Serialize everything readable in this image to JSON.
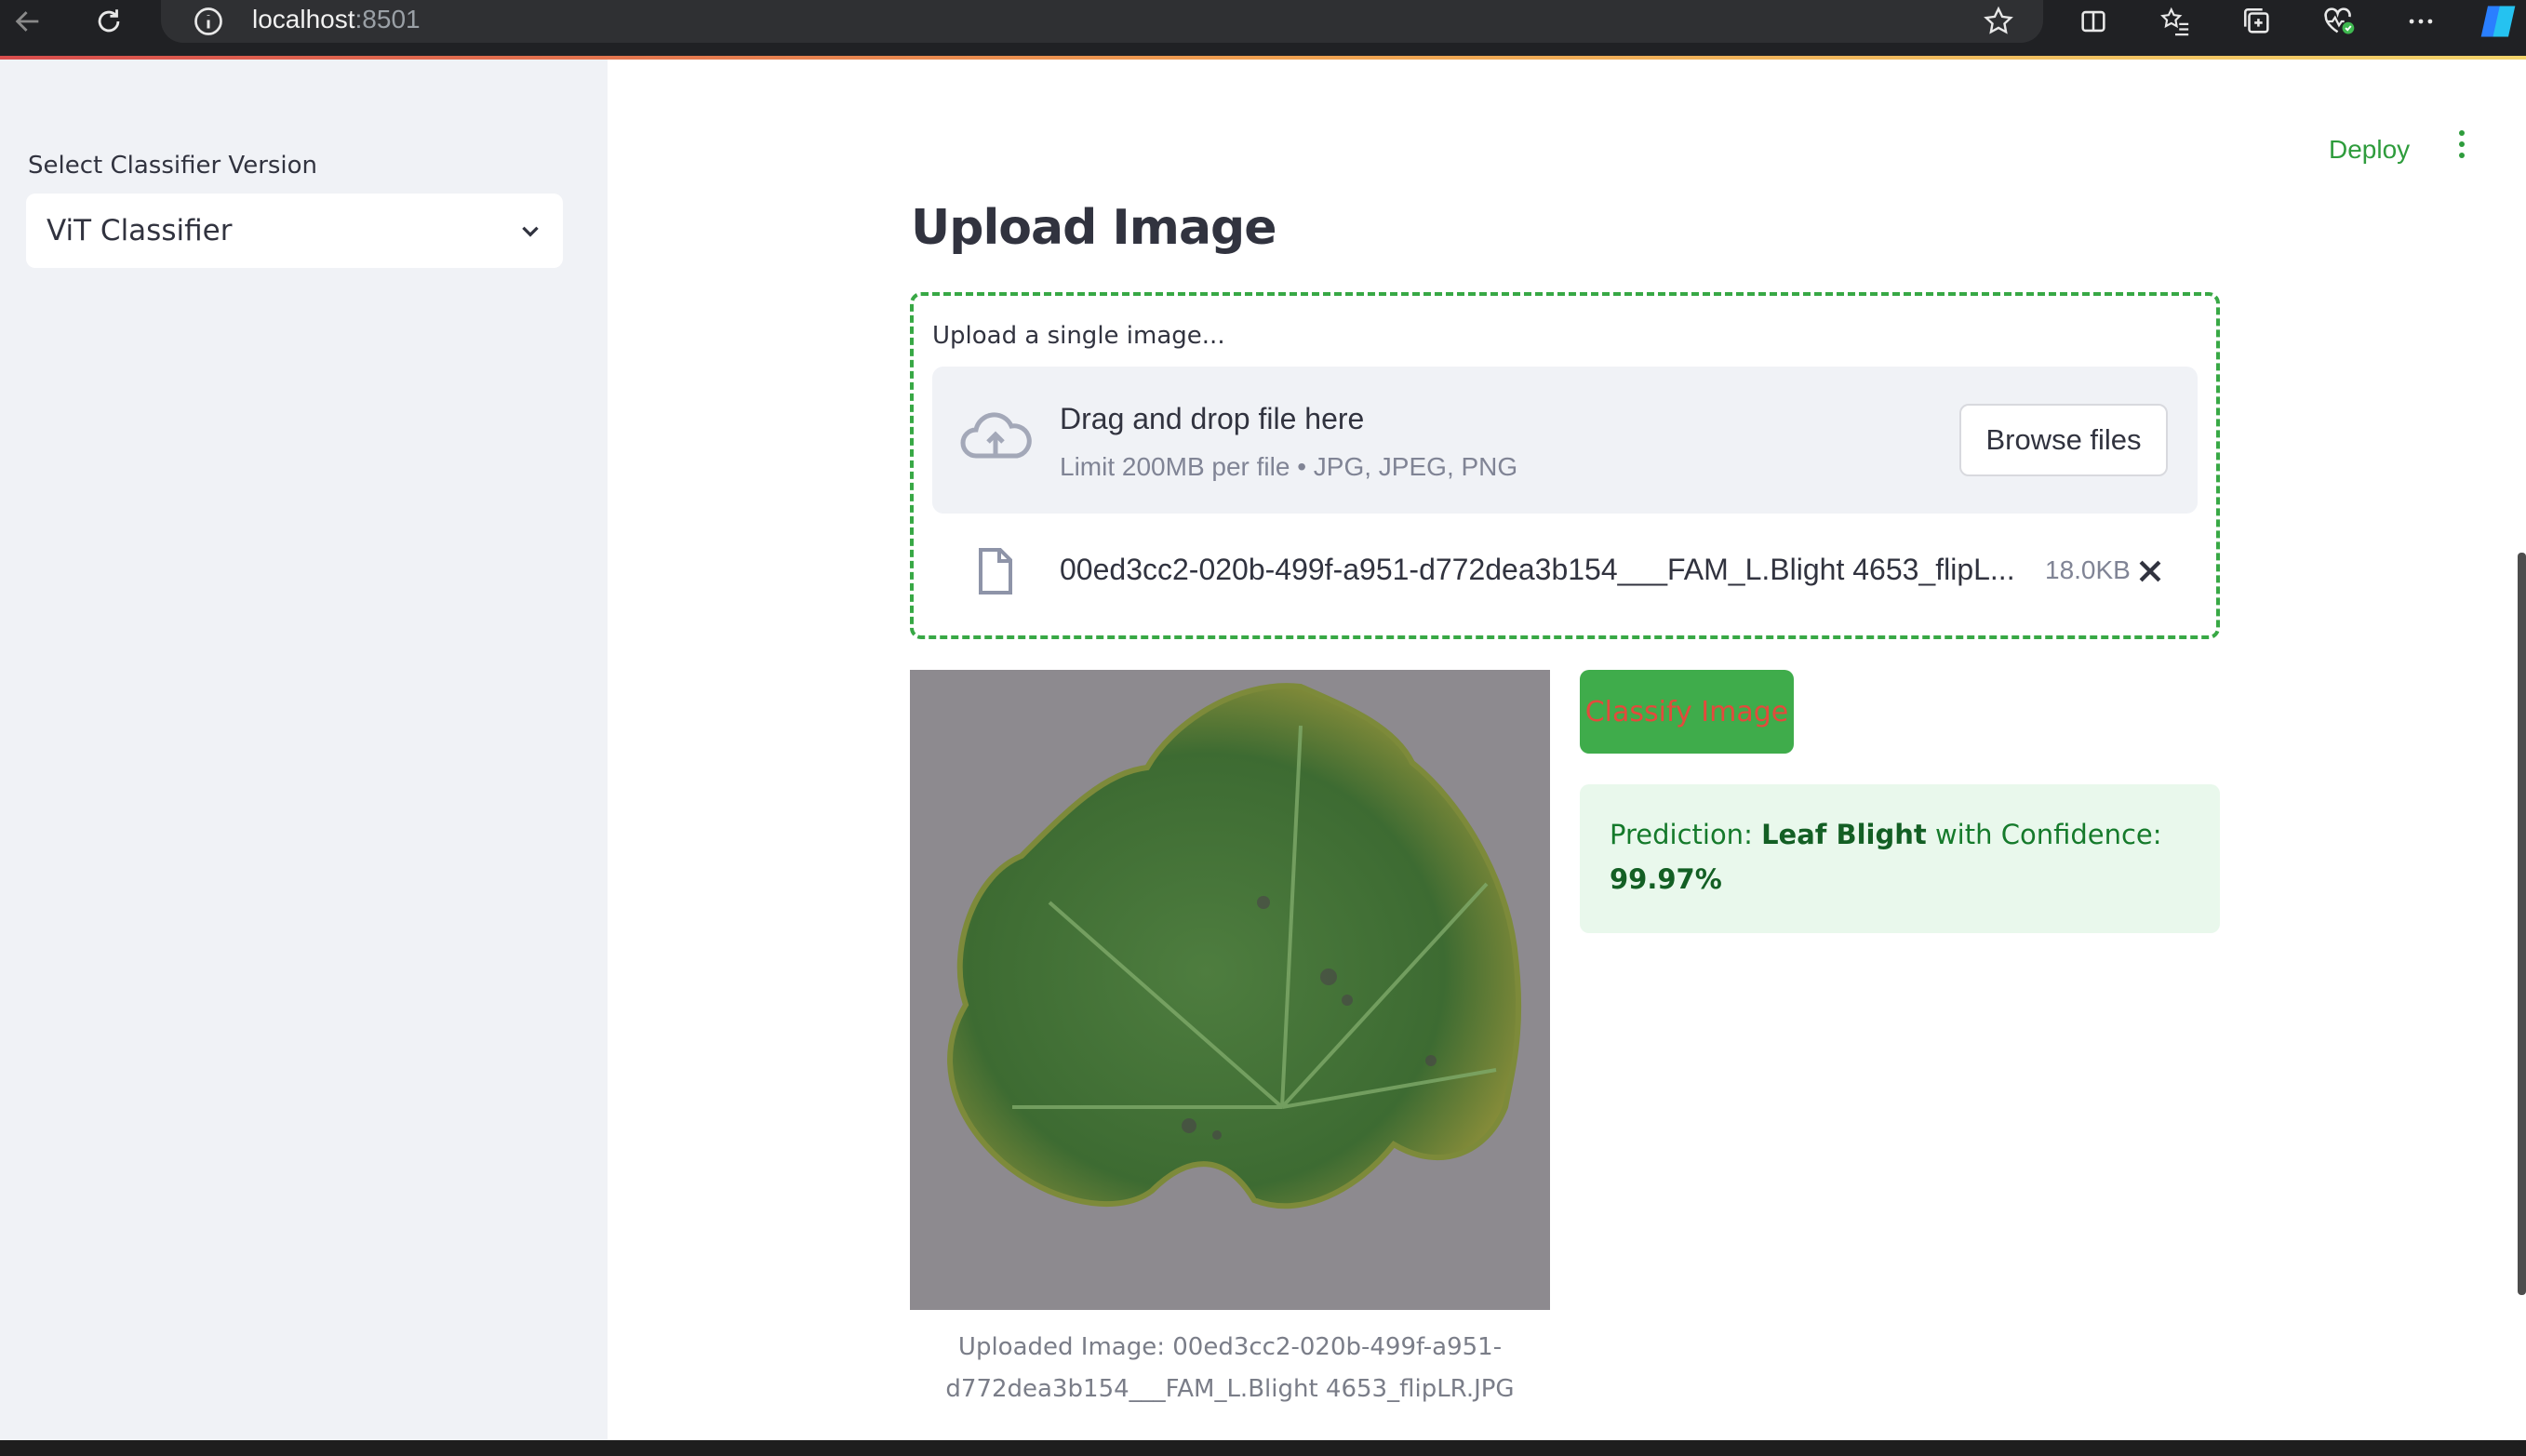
{
  "browser": {
    "url_host": "localhost",
    "url_port": ":8501"
  },
  "sidebar": {
    "label": "Select Classifier Version",
    "selected_classifier": "ViT Classifier"
  },
  "header": {
    "deploy_label": "Deploy"
  },
  "main": {
    "title": "Upload Image",
    "uploader": {
      "label": "Upload a single image...",
      "drop_text": "Drag and drop file here",
      "limit_text": "Limit 200MB per file • JPG, JPEG, PNG",
      "browse_label": "Browse files",
      "file_name": "00ed3cc2-020b-499f-a951-d772dea3b154___FAM_L.Blight 4653_flipL...",
      "file_size": "18.0KB"
    },
    "image_caption_line1": "Uploaded Image: 00ed3cc2-020b-499f-a951-",
    "image_caption_line2": "d772dea3b154___FAM_L.Blight 4653_flipLR.JPG",
    "classify_label": "Classify Image",
    "prediction": {
      "prefix": "Prediction: ",
      "label": "Leaf Blight",
      "middle": " with Confidence: ",
      "confidence": "99.97%"
    }
  },
  "colors": {
    "accent_green": "#38a845",
    "sidebar_bg": "#f0f2f6",
    "success_bg": "#e9f8ec"
  }
}
